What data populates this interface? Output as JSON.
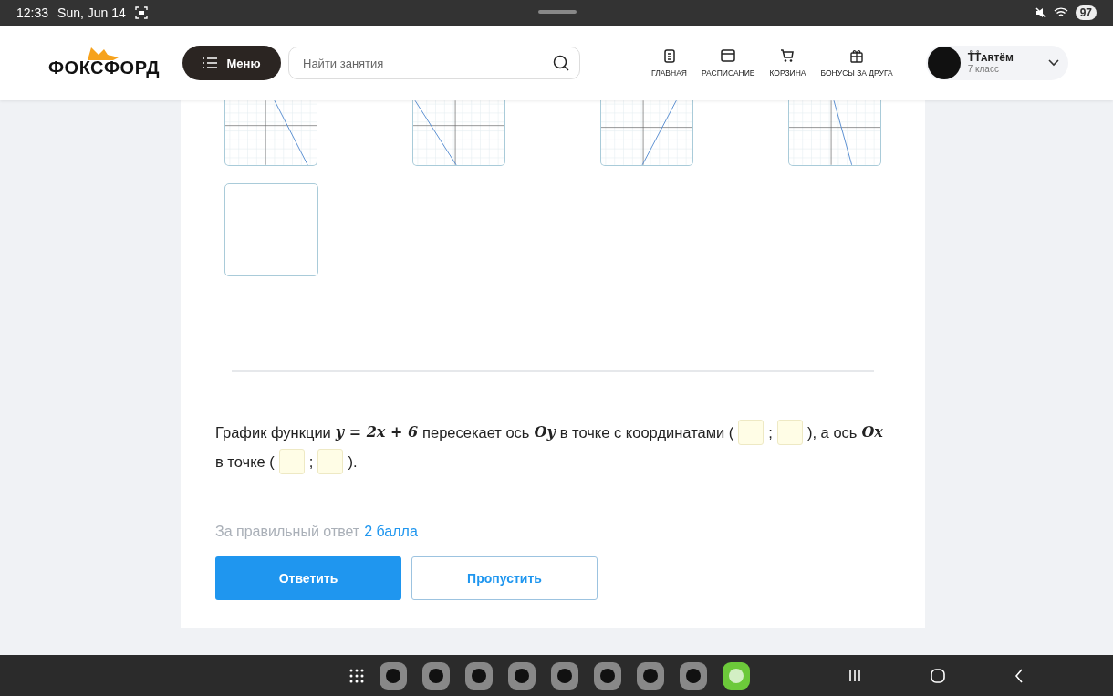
{
  "status_bar": {
    "time": "12:33",
    "date": "Sun, Jun 14",
    "battery": "97"
  },
  "header": {
    "logo": "ФОКСФОРД",
    "menu_button": "Меню",
    "search": {
      "placeholder": "Найти занятия"
    },
    "nav": [
      {
        "kind": "home",
        "label": "ГЛАВНАЯ"
      },
      {
        "kind": "calendar",
        "label": "РАСПИСАНИЕ"
      },
      {
        "kind": "cart",
        "label": "КОРЗИНА"
      },
      {
        "kind": "gift",
        "label": "БОНУСЫ ЗА ДРУГА"
      }
    ],
    "user": {
      "name": "T̊T̊ᴀʀᴛёᴍ",
      "grade": "7 класс"
    }
  },
  "options": [
    {
      "kind": "graph"
    },
    {
      "kind": "graph"
    },
    {
      "kind": "graph"
    },
    {
      "kind": "graph"
    },
    {
      "kind": "empty"
    }
  ],
  "question": [
    {
      "kind": "text",
      "text": "График функции"
    },
    {
      "kind": "math",
      "text": "y = 2x + 6"
    },
    {
      "kind": "text",
      "text": "пересекает ось"
    },
    {
      "kind": "math",
      "text": "Oy"
    },
    {
      "kind": "text",
      "text": "в точке с координатами ("
    },
    {
      "kind": "blank"
    },
    {
      "kind": "text",
      "text": ";"
    },
    {
      "kind": "blank"
    },
    {
      "kind": "text",
      "text": "), а ось"
    },
    {
      "kind": "math",
      "text": "Ox"
    },
    {
      "kind": "text",
      "text": "в точке ("
    },
    {
      "kind": "blank"
    },
    {
      "kind": "text",
      "text": ";"
    },
    {
      "kind": "blank"
    },
    {
      "kind": "text",
      "text": ")."
    }
  ],
  "score": {
    "label": "За правильный ответ",
    "value": "2 балла"
  },
  "buttons": [
    {
      "kind": "primary",
      "label": "Ответить"
    },
    {
      "kind": "secondary",
      "label": "Пропустить"
    }
  ],
  "dock": [
    {
      "kind": "app"
    },
    {
      "kind": "app"
    },
    {
      "kind": "app"
    },
    {
      "kind": "app"
    },
    {
      "kind": "app"
    },
    {
      "kind": "app"
    },
    {
      "kind": "app"
    },
    {
      "kind": "app"
    },
    {
      "kind": "featured"
    }
  ]
}
